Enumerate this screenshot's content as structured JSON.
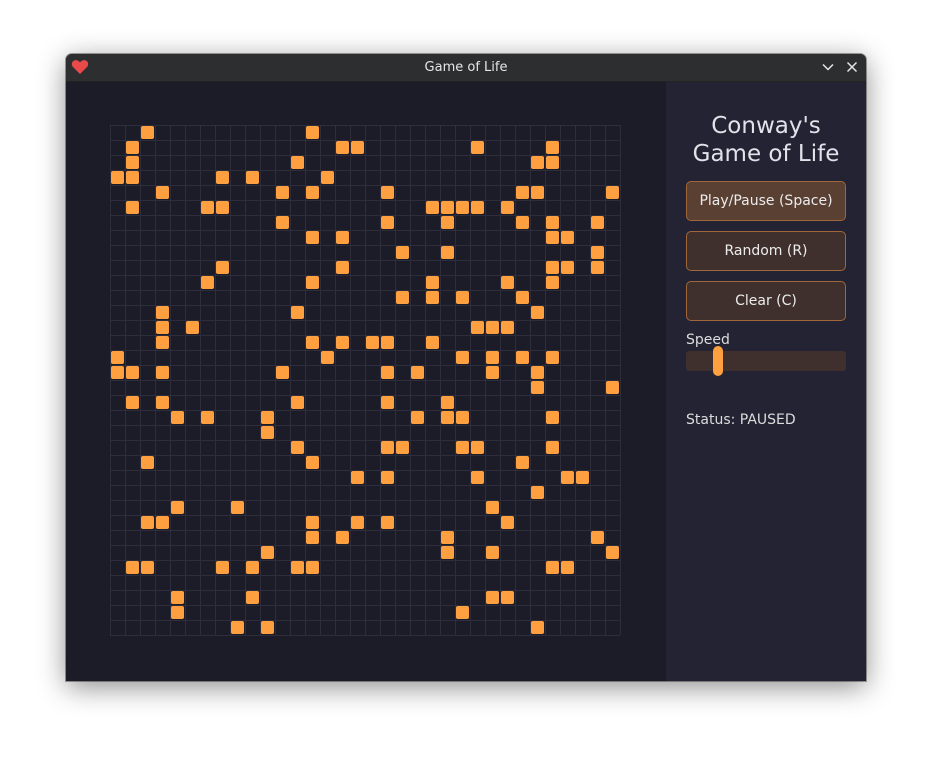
{
  "window": {
    "title": "Game of Life"
  },
  "panel": {
    "title_line1": "Conway's",
    "title_line2": "Game of Life",
    "play_pause_label": "Play/Pause (Space)",
    "random_label": "Random (R)",
    "clear_label": "Clear (C)",
    "speed_label": "Speed",
    "speed_value": 0.18,
    "status_text": "Status: PAUSED"
  },
  "board": {
    "cols": 34,
    "rows": 34,
    "live_color": "#ffa040",
    "grid_color": "#2d2d3c",
    "background_color": "#1c1c28",
    "live_cells": [
      [
        2,
        0
      ],
      [
        13,
        0
      ],
      [
        1,
        1
      ],
      [
        15,
        1
      ],
      [
        16,
        1
      ],
      [
        24,
        1
      ],
      [
        29,
        1
      ],
      [
        1,
        2
      ],
      [
        12,
        2
      ],
      [
        28,
        2
      ],
      [
        29,
        2
      ],
      [
        0,
        3
      ],
      [
        1,
        3
      ],
      [
        7,
        3
      ],
      [
        9,
        3
      ],
      [
        14,
        3
      ],
      [
        3,
        4
      ],
      [
        11,
        4
      ],
      [
        13,
        4
      ],
      [
        18,
        4
      ],
      [
        27,
        4
      ],
      [
        28,
        4
      ],
      [
        33,
        4
      ],
      [
        1,
        5
      ],
      [
        6,
        5
      ],
      [
        7,
        5
      ],
      [
        21,
        5
      ],
      [
        22,
        5
      ],
      [
        23,
        5
      ],
      [
        24,
        5
      ],
      [
        26,
        5
      ],
      [
        11,
        6
      ],
      [
        18,
        6
      ],
      [
        22,
        6
      ],
      [
        27,
        6
      ],
      [
        29,
        6
      ],
      [
        32,
        6
      ],
      [
        13,
        7
      ],
      [
        15,
        7
      ],
      [
        29,
        7
      ],
      [
        30,
        7
      ],
      [
        19,
        8
      ],
      [
        22,
        8
      ],
      [
        32,
        8
      ],
      [
        7,
        9
      ],
      [
        15,
        9
      ],
      [
        29,
        9
      ],
      [
        30,
        9
      ],
      [
        32,
        9
      ],
      [
        6,
        10
      ],
      [
        13,
        10
      ],
      [
        21,
        10
      ],
      [
        26,
        10
      ],
      [
        29,
        10
      ],
      [
        19,
        11
      ],
      [
        21,
        11
      ],
      [
        23,
        11
      ],
      [
        27,
        11
      ],
      [
        3,
        12
      ],
      [
        12,
        12
      ],
      [
        28,
        12
      ],
      [
        3,
        13
      ],
      [
        5,
        13
      ],
      [
        24,
        13
      ],
      [
        25,
        13
      ],
      [
        26,
        13
      ],
      [
        3,
        14
      ],
      [
        13,
        14
      ],
      [
        15,
        14
      ],
      [
        17,
        14
      ],
      [
        18,
        14
      ],
      [
        21,
        14
      ],
      [
        0,
        15
      ],
      [
        14,
        15
      ],
      [
        23,
        15
      ],
      [
        25,
        15
      ],
      [
        27,
        15
      ],
      [
        29,
        15
      ],
      [
        0,
        16
      ],
      [
        1,
        16
      ],
      [
        3,
        16
      ],
      [
        11,
        16
      ],
      [
        18,
        16
      ],
      [
        20,
        16
      ],
      [
        25,
        16
      ],
      [
        28,
        16
      ],
      [
        28,
        17
      ],
      [
        33,
        17
      ],
      [
        1,
        18
      ],
      [
        3,
        18
      ],
      [
        12,
        18
      ],
      [
        18,
        18
      ],
      [
        22,
        18
      ],
      [
        4,
        19
      ],
      [
        6,
        19
      ],
      [
        10,
        19
      ],
      [
        20,
        19
      ],
      [
        22,
        19
      ],
      [
        23,
        19
      ],
      [
        29,
        19
      ],
      [
        10,
        20
      ],
      [
        12,
        21
      ],
      [
        18,
        21
      ],
      [
        19,
        21
      ],
      [
        23,
        21
      ],
      [
        24,
        21
      ],
      [
        29,
        21
      ],
      [
        2,
        22
      ],
      [
        13,
        22
      ],
      [
        27,
        22
      ],
      [
        16,
        23
      ],
      [
        18,
        23
      ],
      [
        24,
        23
      ],
      [
        30,
        23
      ],
      [
        31,
        23
      ],
      [
        28,
        24
      ],
      [
        4,
        25
      ],
      [
        8,
        25
      ],
      [
        25,
        25
      ],
      [
        2,
        26
      ],
      [
        3,
        26
      ],
      [
        13,
        26
      ],
      [
        16,
        26
      ],
      [
        18,
        26
      ],
      [
        26,
        26
      ],
      [
        13,
        27
      ],
      [
        15,
        27
      ],
      [
        22,
        27
      ],
      [
        32,
        27
      ],
      [
        10,
        28
      ],
      [
        22,
        28
      ],
      [
        25,
        28
      ],
      [
        33,
        28
      ],
      [
        1,
        29
      ],
      [
        2,
        29
      ],
      [
        7,
        29
      ],
      [
        9,
        29
      ],
      [
        12,
        29
      ],
      [
        13,
        29
      ],
      [
        29,
        29
      ],
      [
        30,
        29
      ],
      [
        4,
        31
      ],
      [
        9,
        31
      ],
      [
        25,
        31
      ],
      [
        26,
        31
      ],
      [
        4,
        32
      ],
      [
        23,
        32
      ],
      [
        8,
        33
      ],
      [
        10,
        33
      ],
      [
        28,
        33
      ]
    ]
  },
  "icons": {
    "app": "heart-icon",
    "minimize": "chevron-down-icon",
    "close": "close-icon",
    "accent": "#e84a4a"
  }
}
